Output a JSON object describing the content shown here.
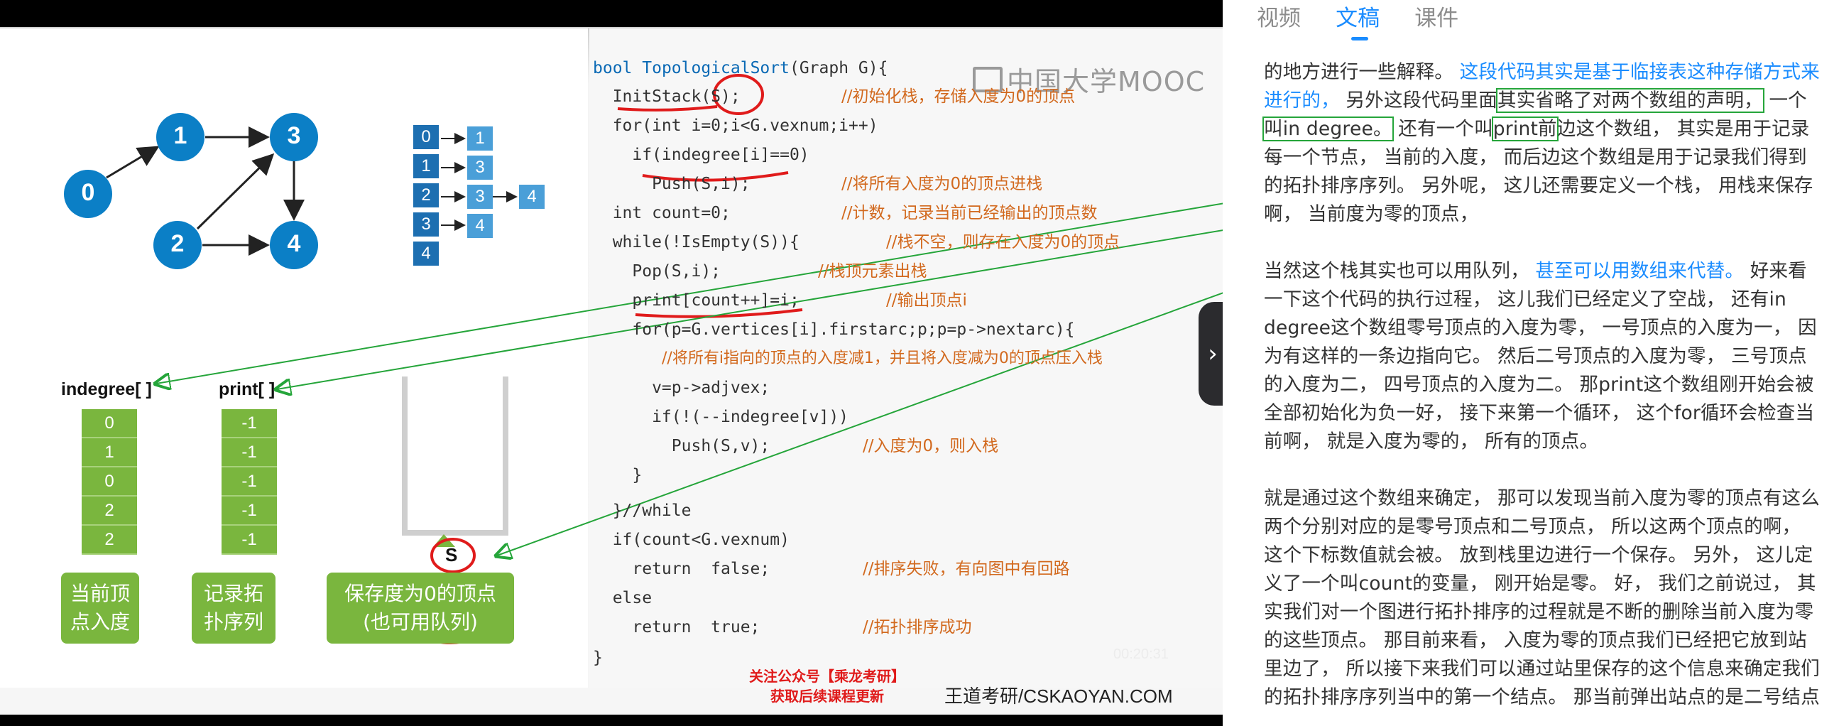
{
  "slide": {
    "watermark": "中国大学MOOC",
    "graph": {
      "nodes": [
        "0",
        "1",
        "2",
        "3",
        "4"
      ]
    },
    "adjacency": {
      "index": [
        "0",
        "1",
        "2",
        "3",
        "4"
      ],
      "row0": [
        "1"
      ],
      "row1": [
        "3"
      ],
      "row2": [
        "3",
        "4"
      ],
      "row3": [
        "4"
      ]
    },
    "indegree": {
      "label": "indegree[ ]",
      "values": [
        "0",
        "1",
        "0",
        "2",
        "2"
      ],
      "caption_l1": "当前顶",
      "caption_l2": "点入度"
    },
    "print": {
      "label": "print[ ]",
      "values": [
        "-1",
        "-1",
        "-1",
        "-1",
        "-1"
      ],
      "caption_l1": "记录拓",
      "caption_l2": "扑序列"
    },
    "stack": {
      "label": "S",
      "caption_l1": "保存度为0的顶点",
      "caption_l2": "(也可用队列)"
    },
    "code": {
      "l1a": "bool ",
      "l1b": "TopologicalSort",
      "l1c": "(Graph G){",
      "l2": "  InitStack(S);",
      "l2c": "//初始化栈，存储入度为0的顶点",
      "l3": "  for(int i=0;i<G.vexnum;i++)",
      "l4": "    if(indegree[i]==0)",
      "l5": "      Push(S,i);",
      "l5c": "//将所有入度为0的顶点进栈",
      "l6": "  int count=0;",
      "l6c": "//计数，记录当前已经输出的顶点数",
      "l7": "  while(!IsEmpty(S)){",
      "l7c": "//栈不空，则存在入度为0的顶点",
      "l8": "    Pop(S,i);",
      "l8c": "//栈顶元素出栈",
      "l9": "    print[count++]=i;",
      "l9c": "//输出顶点i",
      "l10": "    for(p=G.vertices[i].firstarc;p;p=p->nextarc){",
      "l11c": "//将所有i指向的顶点的入度减1，并且将入度减为0的顶点压入栈",
      "l12": "      v=p->adjvex;",
      "l13": "      if(!(--indegree[v]))",
      "l14": "        Push(S,v);",
      "l14c": "//入度为0，则入栈",
      "l15": "    }",
      "l16": "  }//while",
      "l17": "  if(count<G.vexnum)",
      "l18": "    return  false;",
      "l18c": "//排序失败，有向图中有回路",
      "l19": "  else",
      "l20": "    return  true;",
      "l20c": "//拓扑排序成功",
      "l21": "}"
    },
    "footer": {
      "promo_l1": "关注公众号【乘龙考研】",
      "promo_l2": "获取后续课程更新",
      "site": "王道考研/CSKAOYAN.COM"
    },
    "timecode": "00:20:31"
  },
  "panel": {
    "tabs": [
      "视频",
      "文稿",
      "课件"
    ],
    "active_tab": "文稿",
    "transcript": {
      "p1": {
        "s1": "的地方进行一些解释。",
        "s2": "这段代码其实是基于临接表这种存储方式来进行的，",
        "s3": " 另外这段代码里面",
        "s4": "其实省略了对两个数组的声明，",
        "s5": " 一个",
        "s6": "叫in degree。",
        "s7": " 还有一个叫",
        "s8": "print前",
        "s9": "边这个数组， 其实是用于记录每一个节点， 当前的入度， 而后边这个数组是用于记录我们得到的拓扑排序序列。 另外呢， 这儿还需要定义一个栈， 用栈来保存啊， 当前度为零的顶点，"
      },
      "p2": {
        "s1": "当然这个栈其实也可以用队列，",
        "s2": " 甚至可以用数组来代替。",
        "s3": " 好来看一下这个代码的执行过程， 这儿我们已经定义了空战， 还有in degree这个数组零号顶点的入度为零， 一号顶点的入度为一， 因为有这样的一条边指向它。 然后二号顶点的入度为零， 三号顶点的入度为二， 四号顶点的入度为二。 那print这个数组刚开始会被全部初始化为负一好， 接下来第一个循环， 这个for循环会检查当前啊， 就是入度为零的， 所有的顶点。"
      },
      "p3": "就是通过这个数组来确定， 那可以发现当前入度为零的顶点有这么两个分别对应的是零号顶点和二号顶点， 所以这两个顶点的啊， 这个下标数值就会被。 放到栈里边进行一个保存。 另外， 这儿定义了一个叫count的变量， 刚开始是零。 好， 我们之前说过， 其实我们对一个图进行拓扑排序的过程就是不断的删除当前入度为零的这些顶点。 那目前来看， 入度为零的顶点我们已经把它放到站里边了， 所以接下来我们可以通过站里保存的这个信息来确定我们的拓扑排序序列当中的第一个结点。 那当前弹出站点的是二号结点"
    }
  },
  "colors": {
    "accent": "#1a8cff",
    "green": "#7ab63e",
    "node_blue": "#0b7fc6",
    "annotation_red": "#e01b1b",
    "annotation_green": "#25a53a"
  }
}
